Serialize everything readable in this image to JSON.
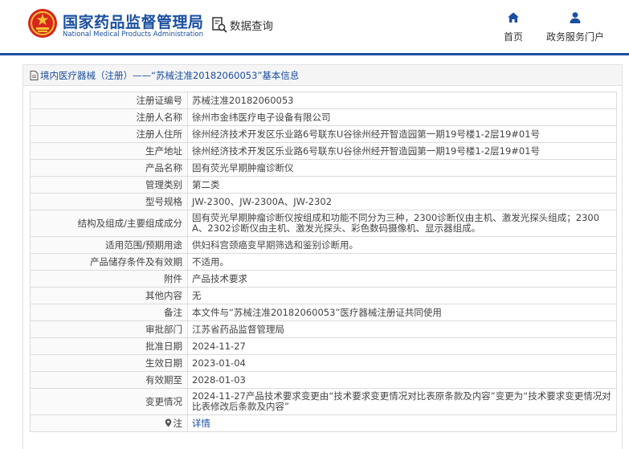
{
  "header": {
    "brand_cn": "国家药品监督管理局",
    "brand_en": "National Medical Products Administration",
    "search_label": "数据查询",
    "nav": {
      "home": "首页",
      "service": "政务服务门户"
    }
  },
  "panel": {
    "title": "境内医疗器械（注册）——“苏械注准20182060053”基本信息"
  },
  "rows": [
    {
      "label": "注册证编号",
      "value": "苏械注准20182060053"
    },
    {
      "label": "注册人名称",
      "value": "徐州市金纬医疗电子设备有限公司"
    },
    {
      "label": "注册人住所",
      "value": "徐州经济技术开发区乐业路6号联东U谷徐州经开智造园第一期19号楼1-2层19#01号"
    },
    {
      "label": "生产地址",
      "value": "徐州经济技术开发区乐业路6号联东U谷徐州经开智造园第一期19号楼1-2层19#01号"
    },
    {
      "label": "产品名称",
      "value": "固有荧光早期肿瘤诊断仪"
    },
    {
      "label": "管理类别",
      "value": "第二类"
    },
    {
      "label": "型号规格",
      "value": "JW-2300、JW-2300A、JW-2302"
    },
    {
      "label": "结构及组成/主要组成成分",
      "value": "固有荧光早期肿瘤诊断仪按组成和功能不同分为三种，2300诊断仪由主机、激发光探头组成；2300A、2302诊断仪由主机、激发光探头、彩色数码摄像机、显示器组成。"
    },
    {
      "label": "适用范围/预期用途",
      "value": "供妇科宫颈癌变早期筛选和鉴别诊断用。"
    },
    {
      "label": "产品储存条件及有效期",
      "value": "不适用。"
    },
    {
      "label": "附件",
      "value": "产品技术要求"
    },
    {
      "label": "其他内容",
      "value": "无"
    },
    {
      "label": "备注",
      "value": "本文件与“苏械注准20182060053”医疗器械注册证共同使用"
    },
    {
      "label": "审批部门",
      "value": "江苏省药品监督管理局"
    },
    {
      "label": "批准日期",
      "value": "2024-11-27"
    },
    {
      "label": "生效日期",
      "value": "2023-01-04"
    },
    {
      "label": "有效期至",
      "value": "2028-01-03"
    },
    {
      "label": "变更情况",
      "value": "2024-11-27产品技术要求变更由“技术要求变更情况对比表原条款及内容”变更为“技术要求变更情况对比表修改后条款及内容”"
    },
    {
      "label": "注",
      "value": "详情"
    }
  ]
}
